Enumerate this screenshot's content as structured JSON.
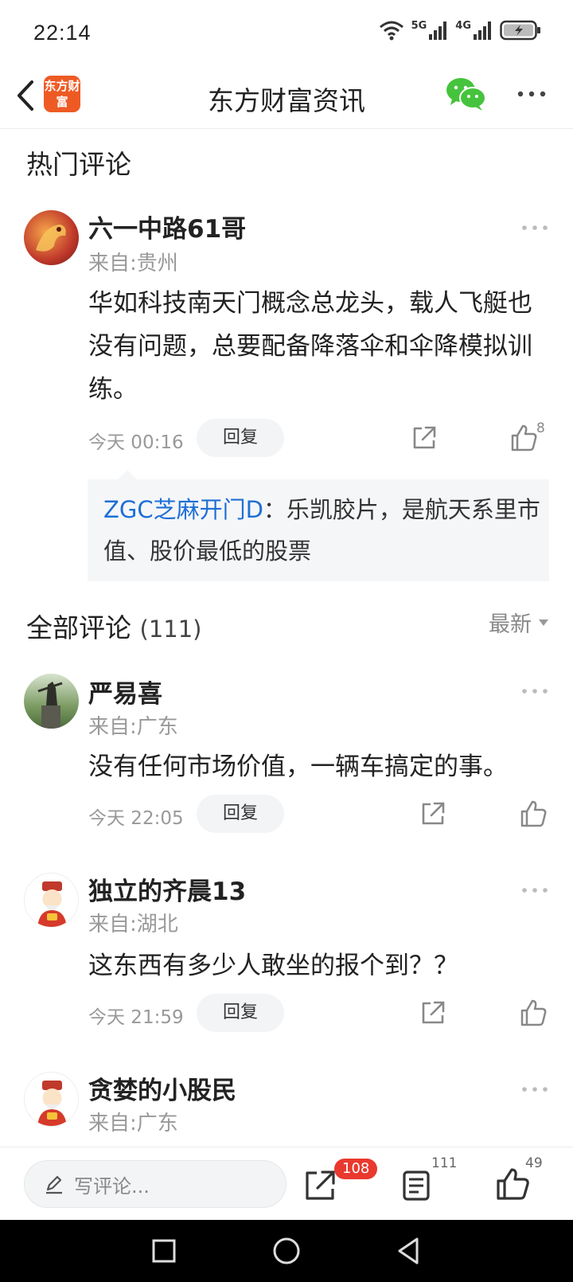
{
  "status_bar": {
    "time": "22:14",
    "net1": "5G",
    "net2": "4G"
  },
  "header": {
    "title": "东方财富资讯",
    "logo_text": "东方财富",
    "logo_color": "#ee5a24",
    "wechat_color": "#46c33d"
  },
  "hot_section": {
    "title": "热门评论"
  },
  "hot_comment": {
    "username": "六一中路61哥",
    "location": "来自:贵州",
    "text": "华如科技南天门概念总龙头，载人飞艇也没有问题，总要配备降落伞和伞降模拟训练。",
    "time": "今天 00:16",
    "reply_label": "回复",
    "likes": "8",
    "reply": {
      "user": "ZGC芝麻开门D",
      "text": "：乐凯胶片，是航天系里市值、股价最低的股票"
    }
  },
  "all_section": {
    "title": "全部评论",
    "count": "(111)",
    "sort_label": "最新"
  },
  "comments": [
    {
      "username": "严易喜",
      "location": "来自:广东",
      "text": "没有任何市场价值，一辆车搞定的事。",
      "time": "今天 22:05",
      "reply_label": "回复"
    },
    {
      "username": "独立的齐晨13",
      "location": "来自:湖北",
      "text": "这东西有多少人敢坐的报个到？？",
      "time": "今天 21:59",
      "reply_label": "回复"
    },
    {
      "username": "贪婪的小股民",
      "location": "来自:广东"
    }
  ],
  "bottom_bar": {
    "write_placeholder": "写评论...",
    "share_badge": "108",
    "comment_count": "111",
    "like_count": "49",
    "badge_color": "#e9392e"
  }
}
